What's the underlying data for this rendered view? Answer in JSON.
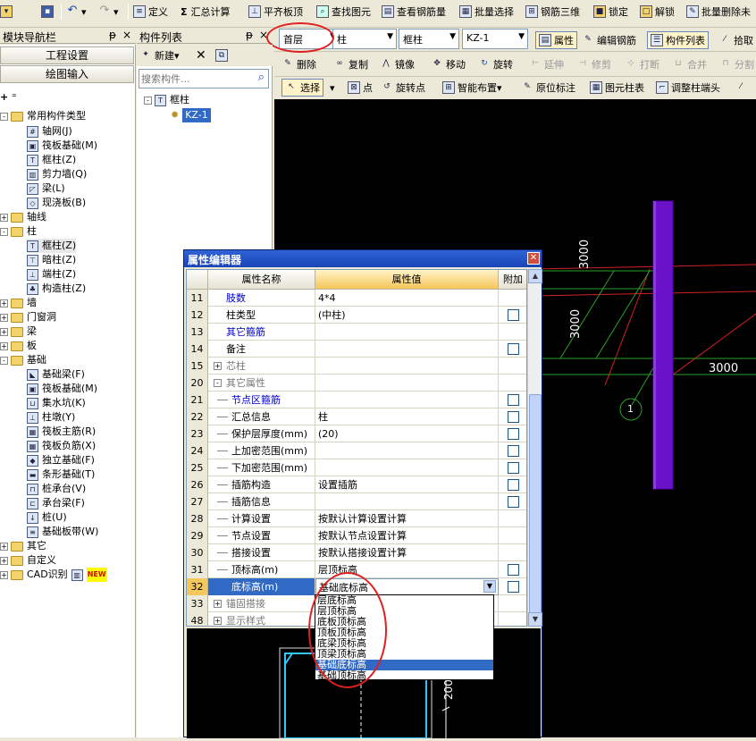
{
  "toolbar1": {
    "define": "定义",
    "sum_calc": "汇总计算",
    "flush_slab": "平齐板顶",
    "find_element": "查找图元",
    "view_rebar": "查看钢筋量",
    "batch_select": "批量选择",
    "rebar_3d": "钢筋三维",
    "lock": "锁定",
    "unlock": "解锁",
    "batch_delete": "批量删除未"
  },
  "toolbar2": {
    "floor": "首层",
    "category": "柱",
    "subtype": "框柱",
    "member": "KZ-1",
    "property": "属性",
    "edit_rebar": "编辑钢筋",
    "member_list": "构件列表",
    "pick": "拾取"
  },
  "toolbar3": {
    "delete": "删除",
    "copy": "复制",
    "mirror": "镜像",
    "move": "移动",
    "rotate": "旋转",
    "extend": "延伸",
    "trim": "修剪",
    "break": "打断",
    "merge": "合并",
    "split": "分割"
  },
  "toolbar4": {
    "select": "选择",
    "point": "点",
    "rotate_point": "旋转点",
    "smart_layout": "智能布置",
    "origin_mark": "原位标注",
    "column_table": "图元柱表",
    "adjust_column_end": "调整柱端头"
  },
  "nav": {
    "title": "模块导航栏",
    "project_settings": "工程设置",
    "drawing_input": "绘图输入"
  },
  "nav_tree": {
    "common": "常用构件类型",
    "common_items": [
      "轴网(J)",
      "筏板基础(M)",
      "框柱(Z)",
      "剪力墙(Q)",
      "梁(L)",
      "现浇板(B)"
    ],
    "axis": "轴线",
    "column": "柱",
    "column_items": [
      "框柱(Z)",
      "暗柱(Z)",
      "端柱(Z)",
      "构造柱(Z)"
    ],
    "wall": "墙",
    "door_window": "门窗洞",
    "beam": "梁",
    "slab": "板",
    "foundation": "基础",
    "foundation_items": [
      "基础梁(F)",
      "筏板基础(M)",
      "集水坑(K)",
      "柱墩(Y)",
      "筏板主筋(R)",
      "筏板负筋(X)",
      "独立基础(F)",
      "条形基础(T)",
      "桩承台(V)",
      "承台梁(F)",
      "桩(U)",
      "基础板带(W)"
    ],
    "other": "其它",
    "custom": "自定义",
    "cad": "CAD识别",
    "new_badge": "NEW"
  },
  "member_list": {
    "title": "构件列表",
    "new_label": "新建",
    "search_placeholder": "搜索构件...",
    "root": "框柱",
    "child": "KZ-1"
  },
  "canvas": {
    "dim1": "3000",
    "dim2": "3000",
    "dim3": "3000",
    "axis_label": "1",
    "dim_small": "200"
  },
  "prop_editor": {
    "title": "属性编辑器",
    "col_name": "属性名称",
    "col_value": "属性值",
    "col_extra": "附加",
    "rows": [
      {
        "n": "11",
        "name": "肢数",
        "value": "4*4",
        "cb": false,
        "blue": true
      },
      {
        "n": "12",
        "name": "柱类型",
        "value": "(中柱)",
        "cb": true
      },
      {
        "n": "13",
        "name": "其它箍筋",
        "value": "",
        "cb": false,
        "blue": true
      },
      {
        "n": "14",
        "name": "备注",
        "value": "",
        "cb": true
      },
      {
        "n": "15",
        "name": "芯柱",
        "value": "",
        "cb": false,
        "exp": "+",
        "grey": true
      },
      {
        "n": "20",
        "name": "其它属性",
        "value": "",
        "cb": false,
        "exp": "-",
        "grey": true
      },
      {
        "n": "21",
        "name": "节点区箍筋",
        "value": "",
        "cb": true,
        "blue": true,
        "sub": true
      },
      {
        "n": "22",
        "name": "汇总信息",
        "value": "柱",
        "cb": true,
        "sub": true
      },
      {
        "n": "23",
        "name": "保护层厚度(mm)",
        "value": "(20)",
        "cb": true,
        "sub": true
      },
      {
        "n": "24",
        "name": "上加密范围(mm)",
        "value": "",
        "cb": true,
        "sub": true
      },
      {
        "n": "25",
        "name": "下加密范围(mm)",
        "value": "",
        "cb": true,
        "sub": true
      },
      {
        "n": "26",
        "name": "插筋构造",
        "value": "设置插筋",
        "cb": true,
        "sub": true
      },
      {
        "n": "27",
        "name": "插筋信息",
        "value": "",
        "cb": true,
        "sub": true
      },
      {
        "n": "28",
        "name": "计算设置",
        "value": "按默认计算设置计算",
        "cb": false,
        "sub": true
      },
      {
        "n": "29",
        "name": "节点设置",
        "value": "按默认节点设置计算",
        "cb": false,
        "sub": true
      },
      {
        "n": "30",
        "name": "搭接设置",
        "value": "按默认搭接设置计算",
        "cb": false,
        "sub": true
      },
      {
        "n": "31",
        "name": "顶标高(m)",
        "value": "层顶标高",
        "cb": true,
        "sub": true
      },
      {
        "n": "32",
        "name": "底标高(m)",
        "value": "基础底标高",
        "cb": true,
        "sub": true,
        "active": true
      },
      {
        "n": "33",
        "name": "锚固搭接",
        "value": "",
        "cb": false,
        "exp": "+",
        "grey": true
      },
      {
        "n": "48",
        "name": "显示样式",
        "value": "",
        "cb": false,
        "exp": "+",
        "grey": true
      }
    ],
    "dropdown": [
      "层底标高",
      "层顶标高",
      "底板顶标高",
      "顶板顶标高",
      "底梁顶标高",
      "顶梁顶标高",
      "基础底标高",
      "基础顶标高"
    ],
    "dropdown_selected": 6
  }
}
